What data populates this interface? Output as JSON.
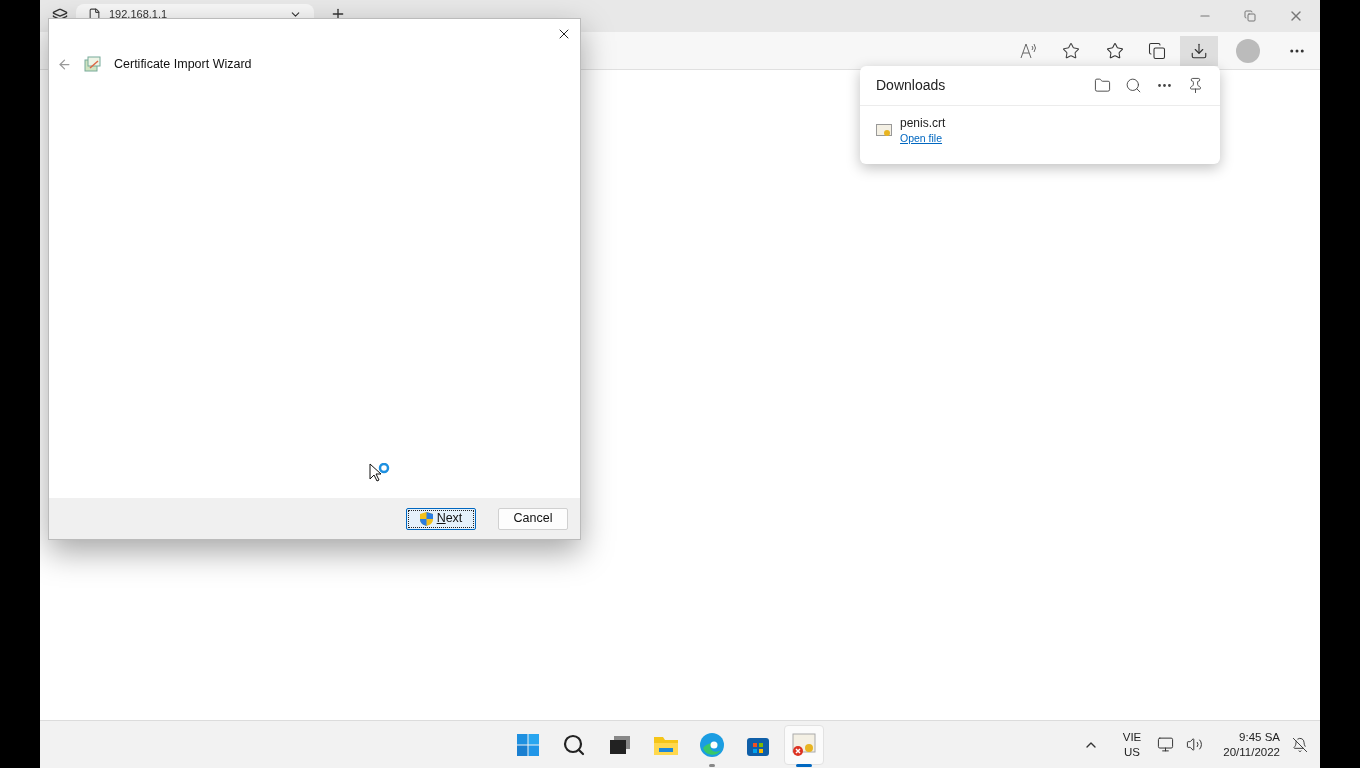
{
  "browser": {
    "tabs": [
      {
        "title": "192.168.1.1",
        "selected": true
      }
    ],
    "downloads_button": {
      "selected": true
    }
  },
  "downloads_panel": {
    "title": "Downloads",
    "items": [
      {
        "file": "penis.crt",
        "action": "Open file"
      }
    ]
  },
  "dialog": {
    "title": "Certificate Import Wizard",
    "buttons": [
      {
        "label": "Next",
        "kind": "elevated",
        "focused": true,
        "mnemonic": true
      },
      {
        "label": "Cancel",
        "kind": "plain",
        "focused": false,
        "mnemonic": false
      }
    ]
  },
  "taskbar": {
    "apps": [
      {
        "kind": "start",
        "running": false,
        "active": false
      },
      {
        "kind": "search",
        "running": false,
        "active": false
      },
      {
        "kind": "taskview",
        "running": false,
        "active": false
      },
      {
        "kind": "explorer",
        "running": false,
        "active": false
      },
      {
        "kind": "edge",
        "running": true,
        "active": false
      },
      {
        "kind": "store",
        "running": false,
        "active": false
      },
      {
        "kind": "certificate",
        "running": true,
        "active": true
      }
    ],
    "language": "VIE",
    "keyboard": "US",
    "time": "9:45 SA",
    "date": "20/11/2022"
  }
}
